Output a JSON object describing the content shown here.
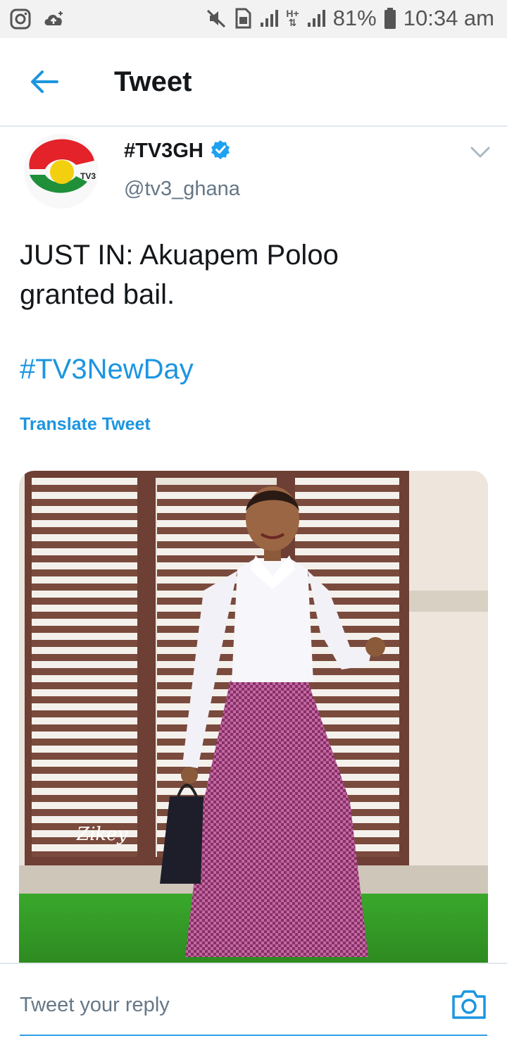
{
  "status_bar": {
    "battery": "81%",
    "time": "10:34 am",
    "network": "H+",
    "icons": [
      "instagram-icon",
      "cloud-upload-icon",
      "mute-icon",
      "sim-icon",
      "signal-icon",
      "battery-icon"
    ]
  },
  "header": {
    "title": "Tweet",
    "back_icon": "arrow-left-icon"
  },
  "tweet": {
    "author_name": "#TV3GH",
    "author_handle": "@tv3_ghana",
    "verified": true,
    "avatar_text": "TV3",
    "text_line1": "JUST IN: Akuapem Poloo",
    "text_line2": "granted bail.",
    "hashtag": "#TV3NewDay",
    "translate_label": "Translate Tweet",
    "media_watermark": "Zikey"
  },
  "reply": {
    "placeholder": "Tweet your reply",
    "camera_icon": "camera-icon"
  },
  "colors": {
    "accent": "#1b95e0",
    "text": "#14171a",
    "muted": "#657786",
    "border": "#e1e8ed"
  }
}
